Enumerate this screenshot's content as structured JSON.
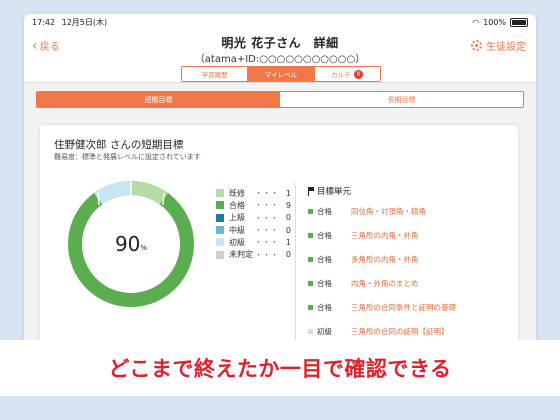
{
  "status": {
    "time": "17:42",
    "date": "12月5日(木)",
    "battery": "100%"
  },
  "header": {
    "back_label": "戻る",
    "title": "明光 花子さん　詳細",
    "subtitle": "（atama+ID:○○○○○○○○○○○）",
    "settings_label": "生徒設定"
  },
  "tabs": [
    {
      "label": "学習履歴",
      "active": false
    },
    {
      "label": "マイレベル",
      "active": true
    },
    {
      "label": "カルテ",
      "active": false,
      "badge": "8"
    }
  ],
  "segments": [
    {
      "label": "短期目標",
      "active": true
    },
    {
      "label": "長期目標",
      "active": false
    }
  ],
  "card": {
    "title": "住野健次郎 さんの短期目標",
    "subtitle": "難易度：標準と発展レベルに設定されています",
    "percent": "90",
    "percent_unit": "%"
  },
  "colors": {
    "accent": "#f0774a",
    "red": "#e0202a",
    "kisyu": "#b5dca5",
    "goukaku": "#5cac50",
    "joukyu": "#1f7a9c",
    "chukyu": "#6cb8d4",
    "shokyu": "#c6e6f2",
    "mihantei": "#cfcfcf"
  },
  "legend": [
    {
      "label": "既修",
      "dots": "・・・",
      "count": "1",
      "color": "#b5dca5"
    },
    {
      "label": "合格",
      "dots": "・・・",
      "count": "9",
      "color": "#5cac50"
    },
    {
      "label": "上級",
      "dots": "・・・",
      "count": "0",
      "color": "#1f7a9c"
    },
    {
      "label": "中級",
      "dots": "・・・",
      "count": "0",
      "color": "#6cb8d4"
    },
    {
      "label": "初級",
      "dots": "・・・",
      "count": "1",
      "color": "#c6e6f2"
    },
    {
      "label": "未判定",
      "dots": "・・・",
      "count": "0",
      "color": "#cfcfcf"
    }
  ],
  "units": {
    "heading": "目標単元",
    "items": [
      {
        "status": "合格",
        "name": "同位角・対頂角・錯角",
        "color": "#5cac50"
      },
      {
        "status": "合格",
        "name": "三角形の内角・外角",
        "color": "#5cac50"
      },
      {
        "status": "合格",
        "name": "多角形の内角・外角",
        "color": "#5cac50"
      },
      {
        "status": "合格",
        "name": "内角・外角のまとめ",
        "color": "#5cac50"
      },
      {
        "status": "合格",
        "name": "三角形の合同条件と証明の基礎",
        "color": "#5cac50"
      },
      {
        "status": "初級",
        "name": "三角形の合同の証明【証明】",
        "color": "#c6e6f2"
      }
    ]
  },
  "banner": {
    "text": "どこまで終えたか一目で確認できる"
  }
}
